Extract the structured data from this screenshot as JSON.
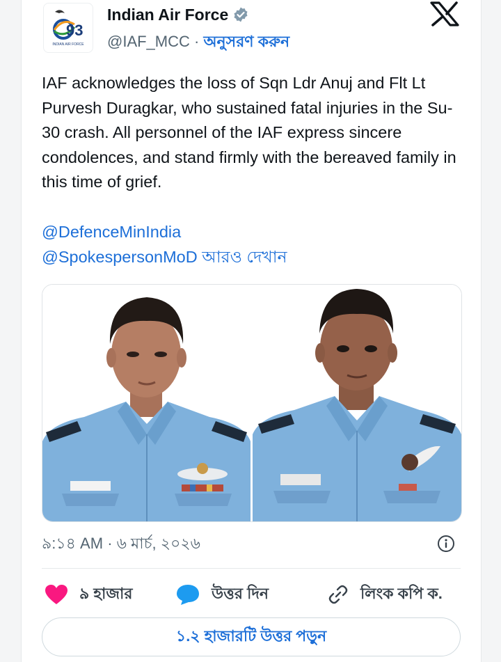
{
  "account": {
    "name": "Indian Air Force",
    "handle": "@IAF_MCC",
    "separator": "·",
    "follow_label": "অনুসরণ করুন",
    "logo_number": "93",
    "logo_caption": "INDIAN AIR FORCE"
  },
  "tweet": {
    "text": "IAF acknowledges the loss of Sqn Ldr Anuj and Flt Lt Purvesh Duragkar, who sustained fatal injuries in the Su-30 crash. All personnel of the IAF express sincere condolences, and stand firmly with the bereaved family in this time of grief.",
    "mention_1": "@DefenceMinIndia",
    "mention_2": "@SpokespersonMoD",
    "show_more": "আরও দেখান"
  },
  "meta": {
    "time": "৯:১৪ AM",
    "separator": "·",
    "date": "৬ মার্চ, ২০২৬"
  },
  "actions": {
    "likes": "৯ হাজার",
    "reply": "উত্তর দিন",
    "copy_link": "লিংক কপি ক."
  },
  "read_replies": "১.২ হাজারটি উত্তর পড়ুন",
  "colors": {
    "link": "#1d6fd8",
    "like": "#f91880",
    "reply_bubble": "#1d9bf0",
    "verified": "#829aab",
    "shirt": "#7fb1dc"
  }
}
